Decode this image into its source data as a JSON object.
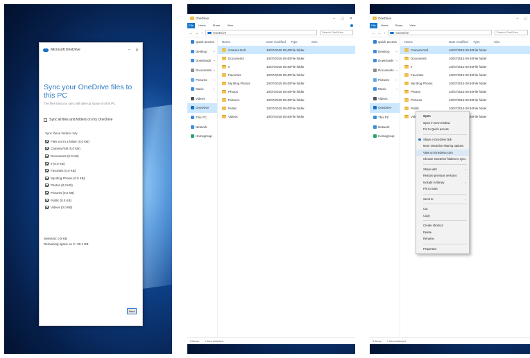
{
  "colors": {
    "desktop_blue": "#0d3f86",
    "accent": "#1979ca",
    "selection": "#cce8ff",
    "folder": "#f2c250",
    "title_blue": "#2b79c2"
  },
  "setup_dialog": {
    "window_title": "Microsoft OneDrive",
    "heading": "Sync your OneDrive files to this PC",
    "subtitle": "The files that you sync will take up space on this PC",
    "sync_all_label": "Sync all files and folders on my OneDrive",
    "sync_group_label": "Sync these folders only",
    "folders": [
      {
        "label": "Files not in a folder (0.0 KB)",
        "checked": true
      },
      {
        "label": "Camera Roll (0.0 KB)",
        "checked": true
      },
      {
        "label": "Documents (0.0 KB)",
        "checked": true
      },
      {
        "label": "e (0.0 KB)",
        "checked": true
      },
      {
        "label": "Favorites (0.0 KB)",
        "checked": true
      },
      {
        "label": "My Blog Photos (0.0 KB)",
        "checked": true
      },
      {
        "label": "Photos (0.0 KB)",
        "checked": true
      },
      {
        "label": "Pictures (0.0 KB)",
        "checked": true
      },
      {
        "label": "Public (0.0 KB)",
        "checked": true
      },
      {
        "label": "Videos (0.0 KB)",
        "checked": true
      }
    ],
    "selected_label": "Selected: 0.0 KB",
    "remaining_label": "Remaining space on C: 39.1 GB",
    "next_button": "Next"
  },
  "explorer": {
    "title": "OneDrive",
    "ribbon_file": "File",
    "ribbon_tabs": [
      "Home",
      "Share",
      "View"
    ],
    "address": "OneDrive",
    "search_placeholder": "Search OneDrive",
    "nav_items": [
      {
        "label": "Quick access",
        "icon": "star-icon",
        "color": "#2f7fd6"
      },
      {
        "label": "Desktop",
        "icon": "desktop-icon",
        "color": "#3b8ee0"
      },
      {
        "label": "Downloads",
        "icon": "download-icon",
        "color": "#3b8ee0"
      },
      {
        "label": "Documents",
        "icon": "documents-icon",
        "color": "#8d8d8d"
      },
      {
        "label": "Pictures",
        "icon": "pictures-icon",
        "color": "#5fa7e6"
      },
      {
        "label": "Music",
        "icon": "music-icon",
        "color": "#3b8ee0"
      },
      {
        "label": "Videos",
        "icon": "videos-icon",
        "color": "#555555"
      },
      {
        "label": "OneDrive",
        "icon": "onedrive-icon",
        "color": "#1570c8"
      },
      {
        "label": "This PC",
        "icon": "pc-icon",
        "color": "#3b8ee0"
      },
      {
        "label": "Network",
        "icon": "network-icon",
        "color": "#3b8ee0"
      },
      {
        "label": "Homegroup",
        "icon": "homegroup-icon",
        "color": "#2aa36b"
      }
    ],
    "columns": [
      "Name",
      "Date modified",
      "Type",
      "Size"
    ],
    "files": [
      {
        "name": "Camera Roll",
        "date": "10/07/2015 09:40",
        "type": "File folder"
      },
      {
        "name": "Documents",
        "date": "10/07/2015 09:40",
        "type": "File folder"
      },
      {
        "name": "e",
        "date": "10/07/2015 09:40",
        "type": "File folder"
      },
      {
        "name": "Favorites",
        "date": "10/07/2015 09:40",
        "type": "File folder"
      },
      {
        "name": "My Blog Photos",
        "date": "10/07/2015 09:40",
        "type": "File folder"
      },
      {
        "name": "Photos",
        "date": "10/07/2015 09:40",
        "type": "File folder"
      },
      {
        "name": "Pictures",
        "date": "10/07/2015 09:40",
        "type": "File folder"
      },
      {
        "name": "Public",
        "date": "10/07/2015 09:40",
        "type": "File folder"
      },
      {
        "name": "Videos",
        "date": "10/07/2015 09:40",
        "type": "File folder"
      }
    ],
    "status_count": "9 items",
    "status_selected": "1 item selected"
  },
  "context_menu": {
    "items": [
      {
        "label": "Open",
        "bold": true
      },
      {
        "label": "Open in new window"
      },
      {
        "label": "Pin to Quick access"
      },
      {
        "sep": true
      },
      {
        "label": "Share a OneDrive link",
        "onedrive": true
      },
      {
        "label": "More OneDrive sharing options"
      },
      {
        "label": "View on OneDrive.com",
        "hl": true
      },
      {
        "label": "Choose OneDrive folders to sync"
      },
      {
        "sep": true
      },
      {
        "label": "Share with",
        "submenu": true
      },
      {
        "label": "Restore previous versions"
      },
      {
        "label": "Include in library",
        "submenu": true
      },
      {
        "label": "Pin to Start"
      },
      {
        "sep": true
      },
      {
        "label": "Send to",
        "submenu": true
      },
      {
        "sep": true
      },
      {
        "label": "Cut"
      },
      {
        "label": "Copy"
      },
      {
        "sep": true
      },
      {
        "label": "Create shortcut"
      },
      {
        "label": "Delete"
      },
      {
        "label": "Rename"
      },
      {
        "sep": true
      },
      {
        "label": "Properties"
      }
    ]
  }
}
